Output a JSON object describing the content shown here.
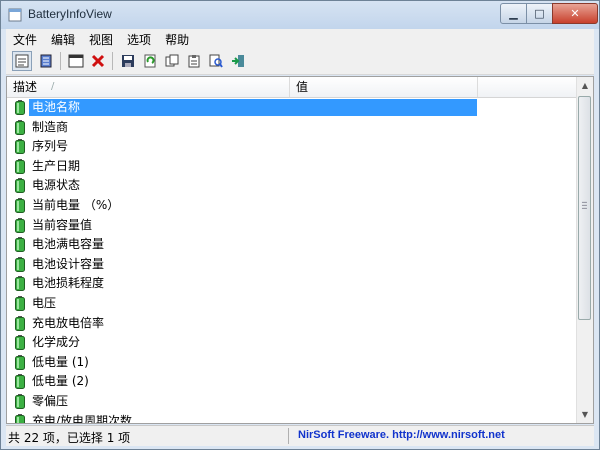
{
  "window": {
    "title": "BatteryInfoView"
  },
  "menu": [
    "文件",
    "编辑",
    "视图",
    "选项",
    "帮助"
  ],
  "toolbar": [
    {
      "icon": "properties-icon"
    },
    {
      "icon": "html-report-icon"
    },
    {
      "icon": "window-icon"
    },
    {
      "icon": "delete-icon"
    },
    {
      "icon": "save-icon"
    },
    {
      "icon": "refresh-icon"
    },
    {
      "icon": "copy-icon"
    },
    {
      "icon": "clipboard-icon"
    },
    {
      "icon": "find-icon"
    },
    {
      "icon": "exit-icon"
    }
  ],
  "columns": {
    "description": "描述",
    "value": "值"
  },
  "rows": [
    "电池名称",
    "制造商",
    "序列号",
    "生产日期",
    "电源状态",
    "当前电量 （%）",
    "当前容量值",
    "电池满电容量",
    "电池设计容量",
    "电池损耗程度",
    "电压",
    "充电放电倍率",
    "化学成分",
    "低电量 (1)",
    "低电量 (2)",
    "零偏压",
    "充电/放电周期次数"
  ],
  "selected_index": 0,
  "status": {
    "left": "共 22 项，已选择 1 项",
    "right": "NirSoft Freeware.  http://www.nirsoft.net"
  },
  "colors": {
    "selection": "#3399ff",
    "battery": "#3cb043",
    "link": "#1133cc"
  }
}
